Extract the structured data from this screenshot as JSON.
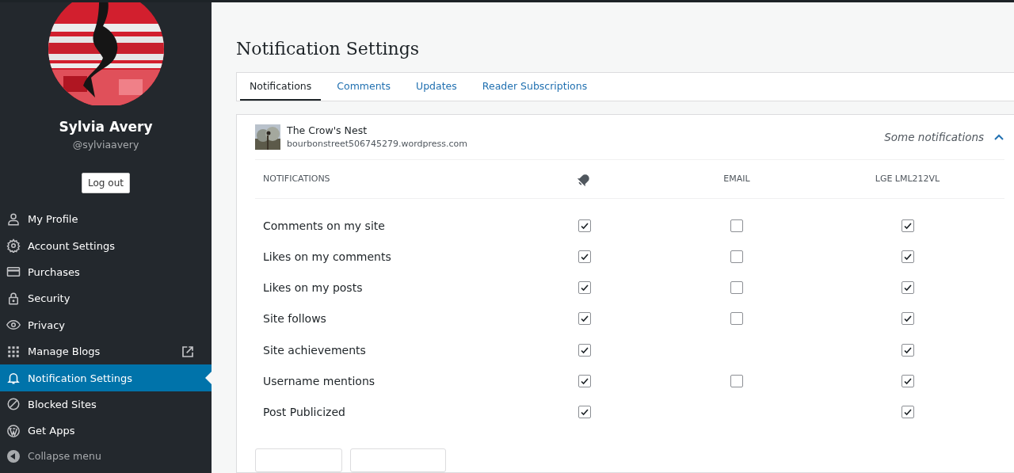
{
  "profile": {
    "name": "Sylvia Avery",
    "username": "@sylviaavery",
    "logout": "Log out"
  },
  "sidebar": {
    "items": [
      {
        "label": "My Profile",
        "selected": false,
        "external": false
      },
      {
        "label": "Account Settings",
        "selected": false,
        "external": false
      },
      {
        "label": "Purchases",
        "selected": false,
        "external": false
      },
      {
        "label": "Security",
        "selected": false,
        "external": false
      },
      {
        "label": "Privacy",
        "selected": false,
        "external": false
      },
      {
        "label": "Manage Blogs",
        "selected": false,
        "external": true
      },
      {
        "label": "Notification Settings",
        "selected": true,
        "external": false
      },
      {
        "label": "Blocked Sites",
        "selected": false,
        "external": false
      },
      {
        "label": "Get Apps",
        "selected": false,
        "external": false
      }
    ],
    "collapse": "Collapse menu"
  },
  "page_title": "Notification Settings",
  "tabs": [
    {
      "label": "Notifications",
      "selected": true
    },
    {
      "label": "Comments",
      "selected": false
    },
    {
      "label": "Updates",
      "selected": false
    },
    {
      "label": "Reader Subscriptions",
      "selected": false
    }
  ],
  "site": {
    "name": "The Crow's Nest",
    "url": "bourbonstreet506745279.wordpress.com",
    "summary": "Some notifications",
    "expanded": true
  },
  "table": {
    "columns": [
      "NOTIFICATIONS",
      "EMAIL",
      "LGE LML212VL"
    ],
    "rows": [
      {
        "label": "Comments on my site",
        "push": true,
        "email": false,
        "device": true
      },
      {
        "label": "Likes on my comments",
        "push": true,
        "email": false,
        "device": true
      },
      {
        "label": "Likes on my posts",
        "push": true,
        "email": false,
        "device": true
      },
      {
        "label": "Site follows",
        "push": true,
        "email": false,
        "device": true
      },
      {
        "label": "Site achievements",
        "push": true,
        "device": true
      },
      {
        "label": "Username mentions",
        "push": true,
        "email": false,
        "device": true
      },
      {
        "label": "Post Publicized",
        "push": true,
        "device": true
      }
    ]
  }
}
